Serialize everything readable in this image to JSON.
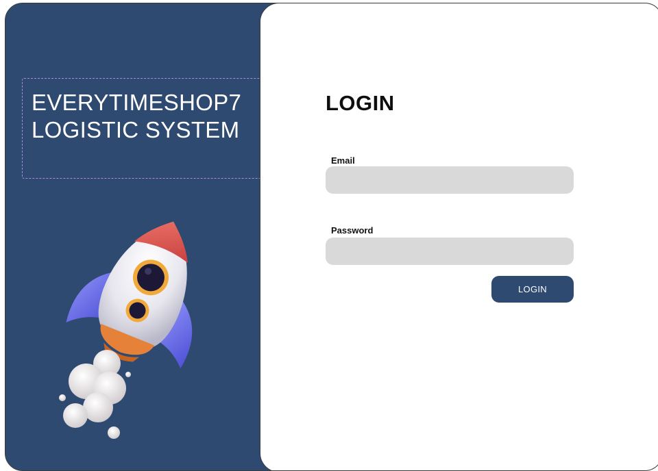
{
  "brand": {
    "line1": "EVERYTIMESHOP7",
    "line2": "LOGISTIC SYSTEM"
  },
  "login": {
    "title": "LOGIN",
    "email_label": "Email",
    "email_value": "",
    "password_label": "Password",
    "password_value": "",
    "button_label": "LOGIN"
  },
  "colors": {
    "panel_navy": "#2f4a70",
    "input_gray": "#d9d9d9",
    "rocket_body": "#ecebf0",
    "rocket_nose": "#e25b5b",
    "rocket_fins": "#6a6ff0",
    "porthole_ring": "#f0a93a"
  },
  "illustration": {
    "name": "rocket-illustration"
  }
}
